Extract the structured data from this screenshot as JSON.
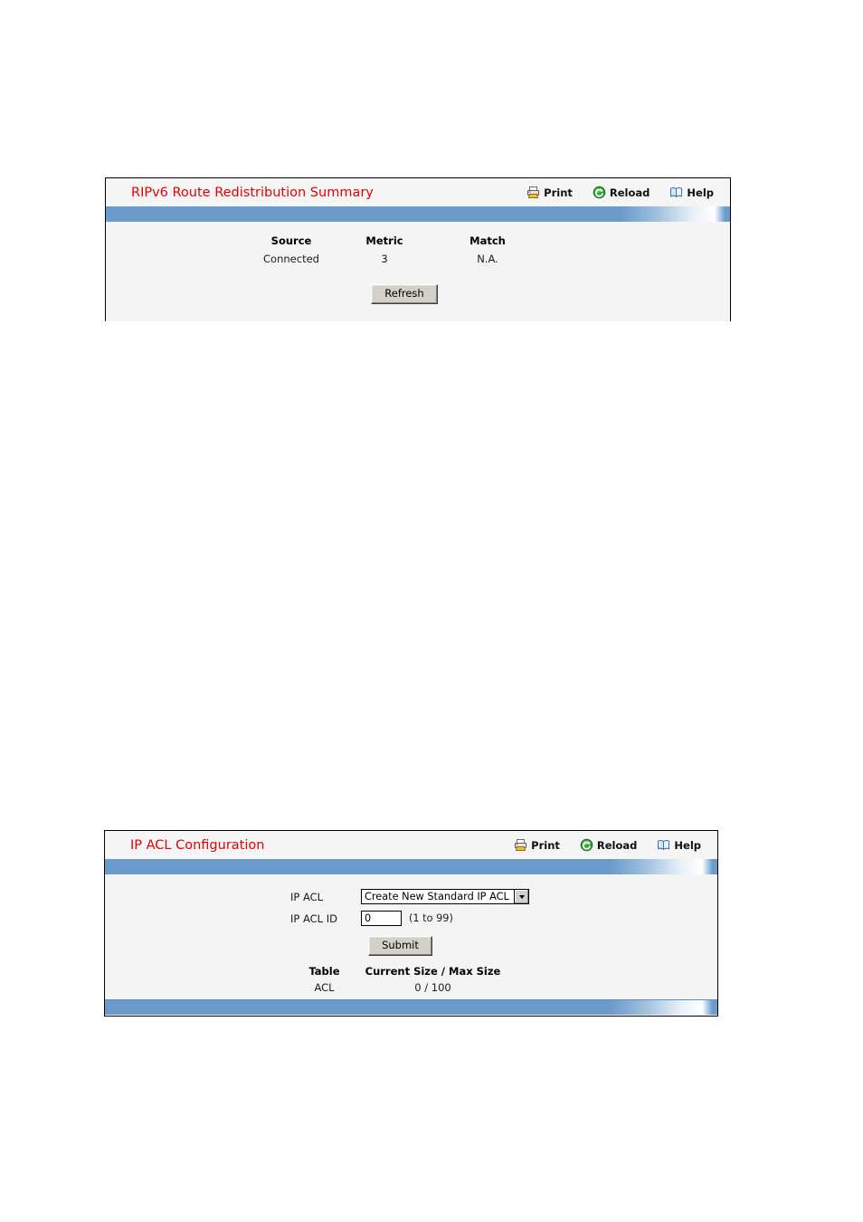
{
  "panels": [
    {
      "id": "ripv6-route-redistribution-summary",
      "title": "RIPv6 Route Redistribution Summary",
      "actions": [
        {
          "label": "Print",
          "icon": "print-icon"
        },
        {
          "label": "Reload",
          "icon": "reload-icon"
        },
        {
          "label": "Help",
          "icon": "help-icon"
        }
      ],
      "table": {
        "headers": [
          "Source",
          "Metric",
          "Match"
        ],
        "rows": [
          [
            "Connected",
            "3",
            "N.A."
          ]
        ]
      },
      "refresh_label": "Refresh"
    },
    {
      "id": "ip-acl-configuration",
      "title": "IP ACL Configuration",
      "actions": [
        {
          "label": "Print",
          "icon": "print-icon"
        },
        {
          "label": "Reload",
          "icon": "reload-icon"
        },
        {
          "label": "Help",
          "icon": "help-icon"
        }
      ],
      "form": {
        "ip_acl_label": "IP ACL",
        "ip_acl_value": "Create New Standard IP ACL",
        "ip_acl_options": [
          "Create New Standard IP ACL"
        ],
        "ip_acl_id_label": "IP ACL ID",
        "ip_acl_id_value": "0",
        "ip_acl_id_hint": "(1 to 99)",
        "submit_label": "Submit"
      },
      "size_table": {
        "headers": [
          "Table",
          "Current Size / Max Size"
        ],
        "rows": [
          [
            "ACL",
            "0 / 100"
          ]
        ]
      }
    }
  ],
  "colors": {
    "title_red": "#e60000",
    "bar_blue": "#6b9bcb",
    "panel_bg": "#f4f4f4",
    "titlebar_bg": "#f5f5f5",
    "button_face": "#d4d0c8",
    "page_bg": "#ffffff"
  }
}
